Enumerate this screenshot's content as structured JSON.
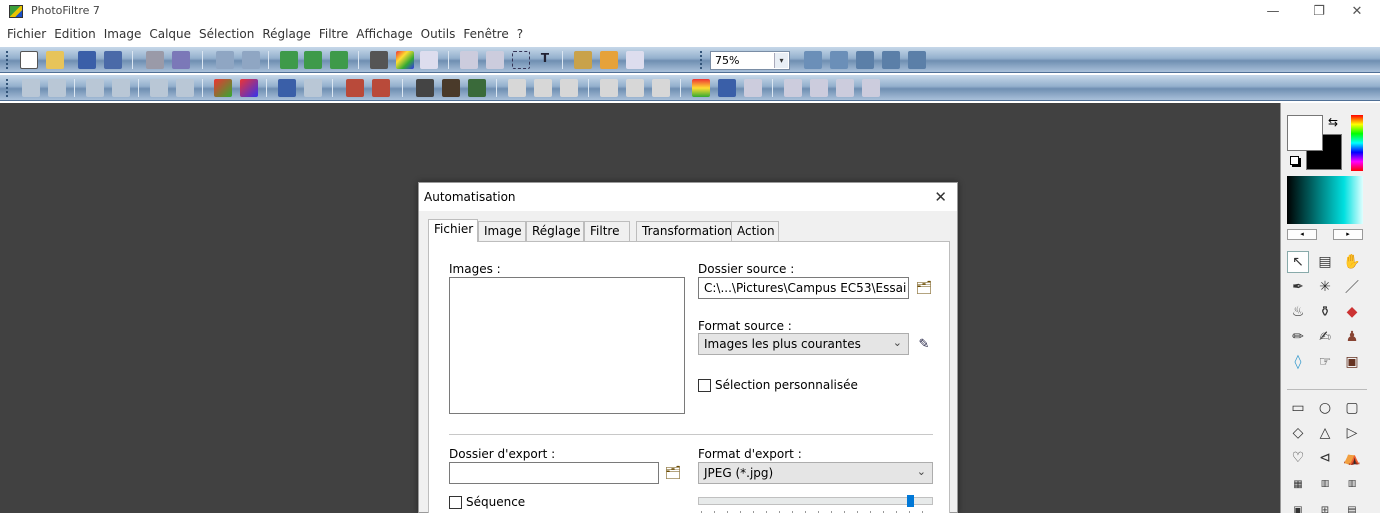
{
  "app": {
    "title": "PhotoFiltre 7",
    "window_buttons": {
      "minimize": "—",
      "maximize": "❐",
      "close": "✕"
    }
  },
  "menu": [
    "Fichier",
    "Edition",
    "Image",
    "Calque",
    "Sélection",
    "Réglage",
    "Filtre",
    "Affichage",
    "Outils",
    "Fenêtre",
    "?"
  ],
  "toolbar": {
    "zoom_value": "75%",
    "zoom_arrow": "▾"
  },
  "dialog": {
    "title": "Automatisation",
    "close_glyph": "✕",
    "tabs": [
      "Fichier",
      "Image",
      "Réglage",
      "Filtre",
      "Transformation",
      "Action"
    ],
    "active_tab": "Fichier",
    "images_label": "Images :",
    "source_folder_label": "Dossier source :",
    "source_folder_value": "C:\\...\\Pictures\\Campus EC53\\Essai",
    "source_format_label": "Format source :",
    "source_format_value": "Images les plus courantes",
    "custom_selection_label": "Sélection personnalisée",
    "export_folder_label": "Dossier d'export :",
    "export_folder_value": "",
    "export_format_label": "Format d'export :",
    "export_format_value": "JPEG (*.jpg)",
    "sequence_label": "Séquence",
    "quality_level": 0.9
  },
  "palette": {
    "foreground": "#ffffff",
    "background": "#000000",
    "left_arrow": "◂",
    "right_arrow": "▸"
  },
  "icons": {
    "swap": "⇆",
    "folder": "🗂",
    "edit": "✎",
    "combo_arrow": "⌄"
  }
}
